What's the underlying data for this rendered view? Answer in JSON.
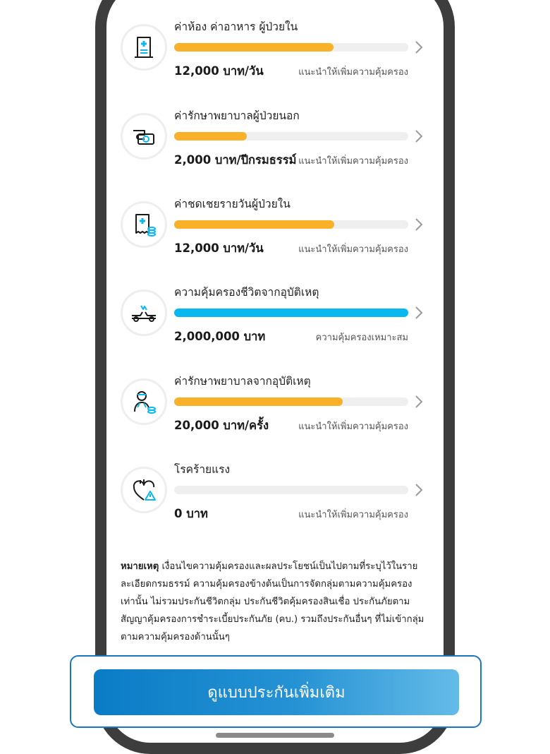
{
  "colors": {
    "bar_recommended": "#f9b12a",
    "bar_adequate": "#0ab8f0",
    "bar_track": "#efefef",
    "cta_start": "#0a7cc6",
    "cta_end": "#64bbe8",
    "icon_accent": "#0ab8f0"
  },
  "coverage_items": [
    {
      "title": "ค่าห้อง ค่าอาหาร ผู้ป่วยใน",
      "amount": "12,000 บาท/วัน",
      "status": "แนะนำให้เพิ่มความคุ้มครอง",
      "progress": 0.68,
      "bar_color": "#f9b12a",
      "icon": "hospital-bed-icon"
    },
    {
      "title": "ค่ารักษาพยาบาลผู้ป่วยนอก",
      "amount": "2,000 บาท/ปีกรมธรรม์",
      "status": "แนะนำให้เพิ่มความคุ้มครอง",
      "progress": 0.31,
      "bar_color": "#f9b12a",
      "icon": "hand-payment-icon"
    },
    {
      "title": "ค่าชดเชยรายวันผู้ป่วยใน",
      "amount": "12,000 บาท/วัน",
      "status": "แนะนำให้เพิ่มความคุ้มครอง",
      "progress": 0.685,
      "bar_color": "#f9b12a",
      "icon": "medical-bill-coins-icon"
    },
    {
      "title": "ความคุ้มครองชีวิตจากอุบัติเหตุ",
      "amount": "2,000,000 บาท",
      "status": "ความคุ้มครองเหมาะสม",
      "progress": 1.0,
      "bar_color": "#0ab8f0",
      "icon": "car-accident-icon"
    },
    {
      "title": "ค่ารักษาพยาบาลจากอุบัติเหตุ",
      "amount": "20,000 บาท/ครั้ง",
      "status": "แนะนำให้เพิ่มความคุ้มครอง",
      "progress": 0.72,
      "bar_color": "#f9b12a",
      "icon": "injured-person-coins-icon"
    },
    {
      "title": "โรคร้ายแรง",
      "amount": "0 บาท",
      "status": "แนะนำให้เพิ่มความคุ้มครอง",
      "progress": 0.0,
      "bar_color": "#f9b12a",
      "icon": "heart-warning-icon"
    }
  ],
  "note": {
    "label": "หมายเหตุ",
    "text": " เงื่อนไขความคุ้มครองและผลประโยชน์เป็นไปตามที่ระบุไว้ในรายละเอียดกรมธรรม์ ความคุ้มครองข้างต้นเป็นการจัดกลุ่มตามความคุ้มครองเท่านั้น ไม่รวมประกันชีวิตกลุ่ม ประกันชีวิตคุ้มครองสินเชื่อ ประกันภัยตามสัญญาคุ้มครองการชำระเบี้ยประกันภัย (คบ.) รวมถึงประกันอื่นๆ ที่ไม่เข้ากลุ่มตามความคุ้มครองด้านนั้นๆ"
  },
  "cta": {
    "label": "ดูแบบประกันเพิ่มเติม"
  }
}
